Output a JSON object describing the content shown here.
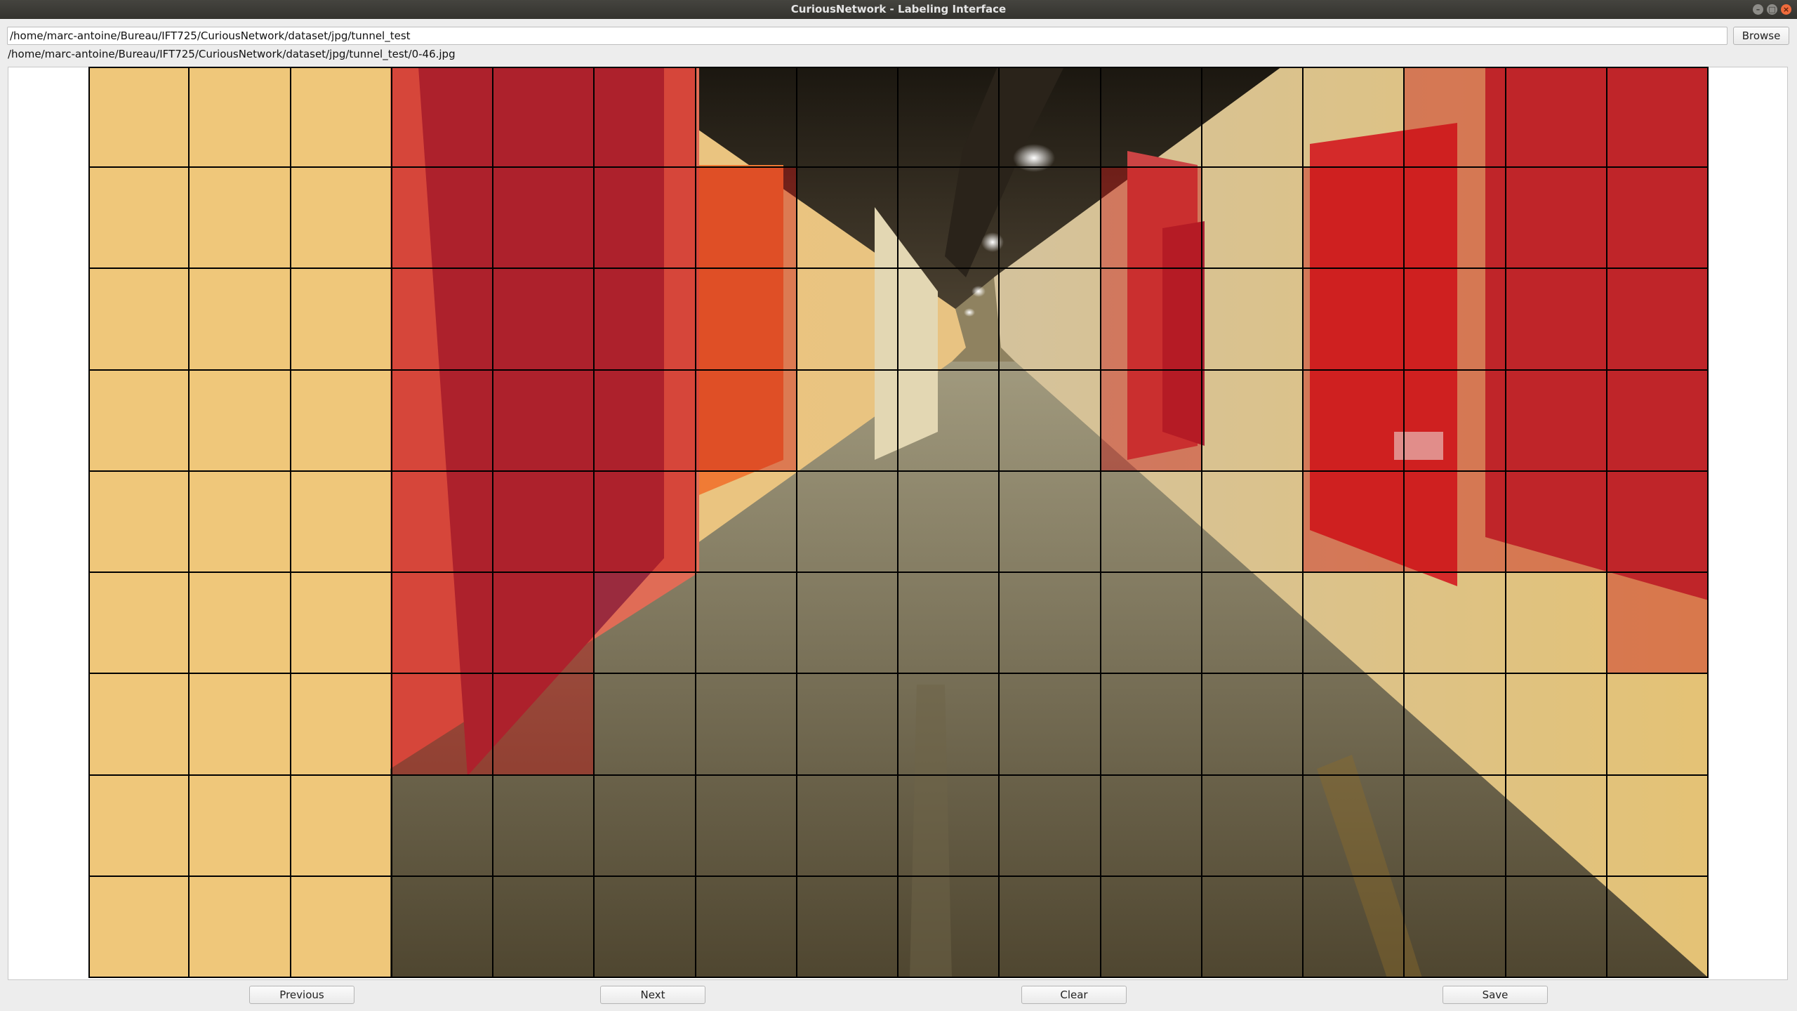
{
  "window": {
    "title": "CuriousNetwork - Labeling Interface"
  },
  "directory": {
    "value": "/home/marc-antoine/Bureau/IFT725/CuriousNetwork/dataset/jpg/tunnel_test"
  },
  "browse_label": "Browse",
  "current_file": "/home/marc-antoine/Bureau/IFT725/CuriousNetwork/dataset/jpg/tunnel_test/0-46.jpg",
  "grid": {
    "rows": 9,
    "cols": 16,
    "selected": [
      [
        0,
        3
      ],
      [
        0,
        4
      ],
      [
        0,
        5
      ],
      [
        0,
        13
      ],
      [
        0,
        14
      ],
      [
        0,
        15
      ],
      [
        1,
        3
      ],
      [
        1,
        4
      ],
      [
        1,
        5
      ],
      [
        1,
        6
      ],
      [
        1,
        10
      ],
      [
        1,
        12
      ],
      [
        1,
        13
      ],
      [
        1,
        14
      ],
      [
        1,
        15
      ],
      [
        2,
        3
      ],
      [
        2,
        4
      ],
      [
        2,
        5
      ],
      [
        2,
        6
      ],
      [
        2,
        10
      ],
      [
        2,
        12
      ],
      [
        2,
        13
      ],
      [
        2,
        14
      ],
      [
        2,
        15
      ],
      [
        3,
        3
      ],
      [
        3,
        4
      ],
      [
        3,
        5
      ],
      [
        3,
        6
      ],
      [
        3,
        10
      ],
      [
        3,
        12
      ],
      [
        3,
        13
      ],
      [
        3,
        14
      ],
      [
        3,
        15
      ],
      [
        4,
        3
      ],
      [
        4,
        4
      ],
      [
        4,
        5
      ],
      [
        4,
        12
      ],
      [
        4,
        13
      ],
      [
        4,
        14
      ],
      [
        4,
        15
      ],
      [
        5,
        3
      ],
      [
        5,
        4
      ],
      [
        5,
        15
      ],
      [
        6,
        3
      ],
      [
        6,
        4
      ]
    ]
  },
  "buttons": {
    "previous": "Previous",
    "next": "Next",
    "clear": "Clear",
    "save": "Save"
  }
}
